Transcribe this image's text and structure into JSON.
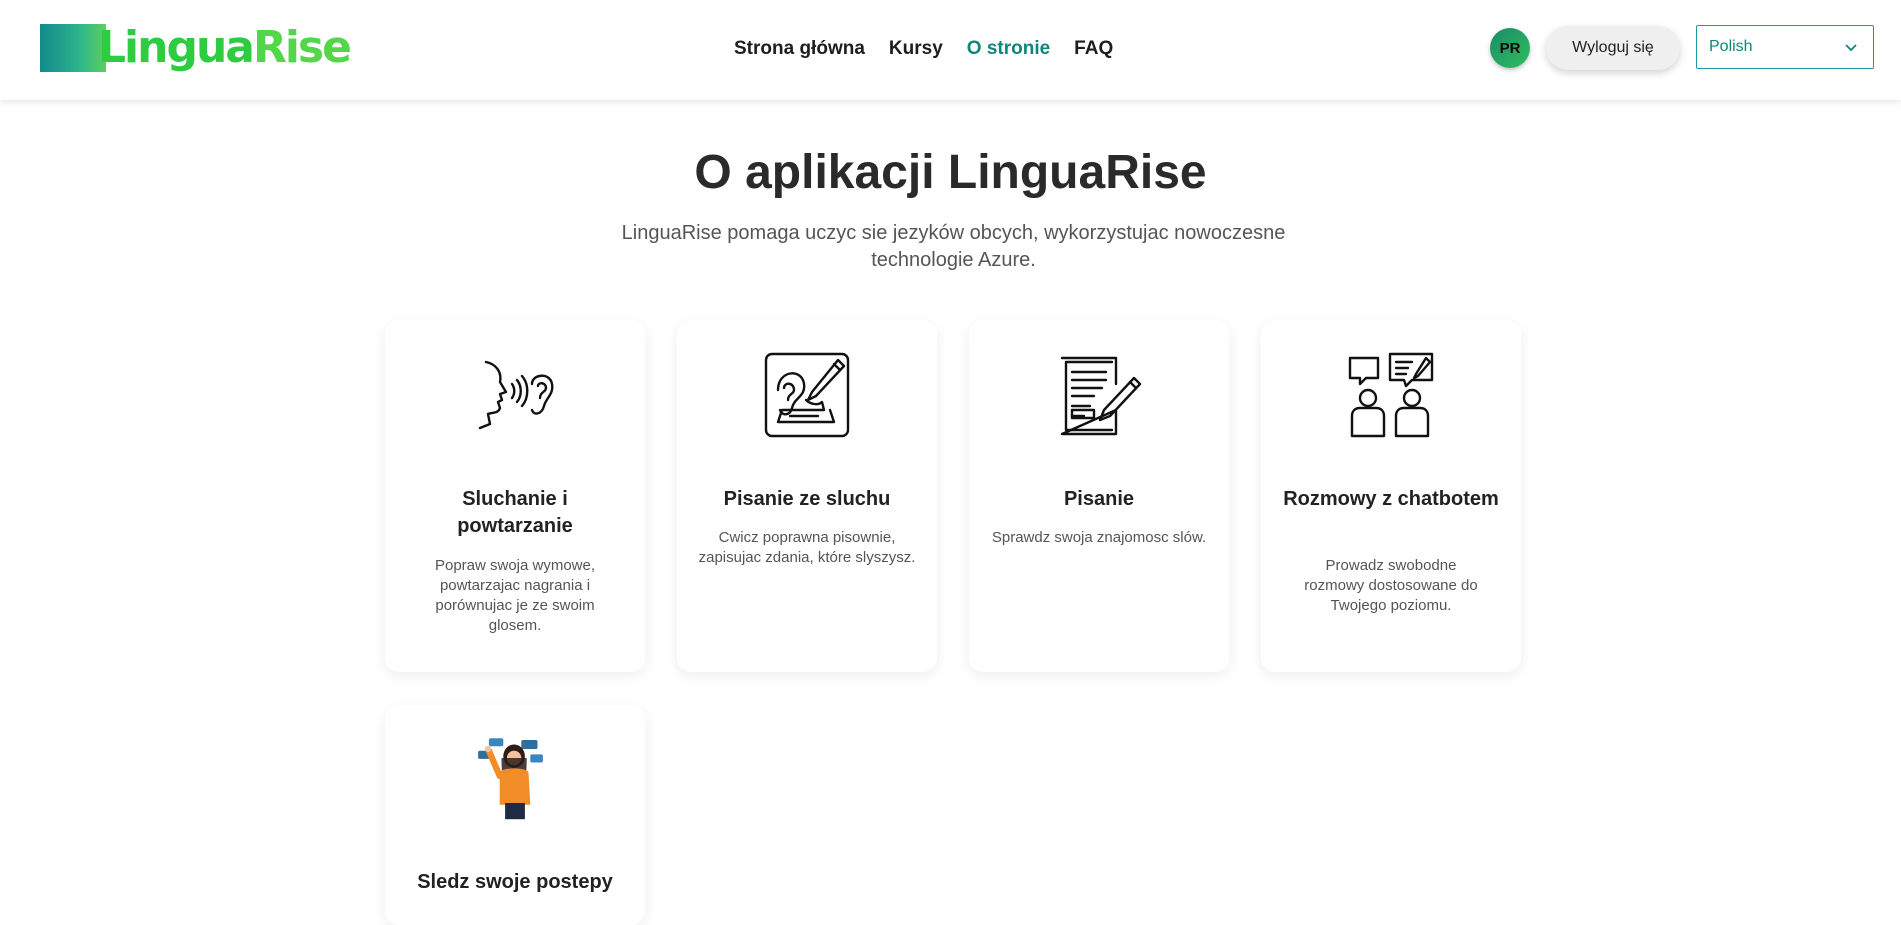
{
  "header": {
    "logo": {
      "text_part1": "Lingua",
      "text_part2": "Rise"
    },
    "nav": [
      {
        "label": "Strona główna",
        "active": false
      },
      {
        "label": "Kursy",
        "active": false
      },
      {
        "label": "O stronie",
        "active": true
      },
      {
        "label": "FAQ",
        "active": false
      }
    ],
    "avatar_initials": "PR",
    "logout_label": "Wyloguj się",
    "language_select": {
      "value": "Polish",
      "icon": "chevron-down-icon"
    }
  },
  "hero": {
    "title": "O aplikacji LinguaRise",
    "subtitle": "LinguaRise pomaga uczyc sie jezyków obcych, wykorzystujac nowoczesne technologie Azure."
  },
  "features": [
    {
      "icon": "speaking-listening-icon",
      "title": "Sluchanie i powtarzanie",
      "description": "Popraw swoja wymowe, powtarzajac nagrania i porównujac je ze swoim glosem."
    },
    {
      "icon": "ear-writing-icon",
      "title": "Pisanie ze sluchu",
      "description": "Cwicz poprawna pisownie, zapisujac zdania, które slyszysz."
    },
    {
      "icon": "document-pencil-icon",
      "title": "Pisanie",
      "description": "Sprawdz swoja znajomosc slów."
    },
    {
      "icon": "chat-people-icon",
      "title": "Rozmowy z chatbotem",
      "description": "Prowadz swobodne rozmowy dostosowane do Twojego poziomu."
    },
    {
      "icon": "woman-speech-bubbles-illustration",
      "title": "Sledz swoje postepy",
      "description": ""
    }
  ],
  "colors": {
    "accent": "#11857a",
    "logo_green": "#2ecc40",
    "text": "#222222"
  }
}
